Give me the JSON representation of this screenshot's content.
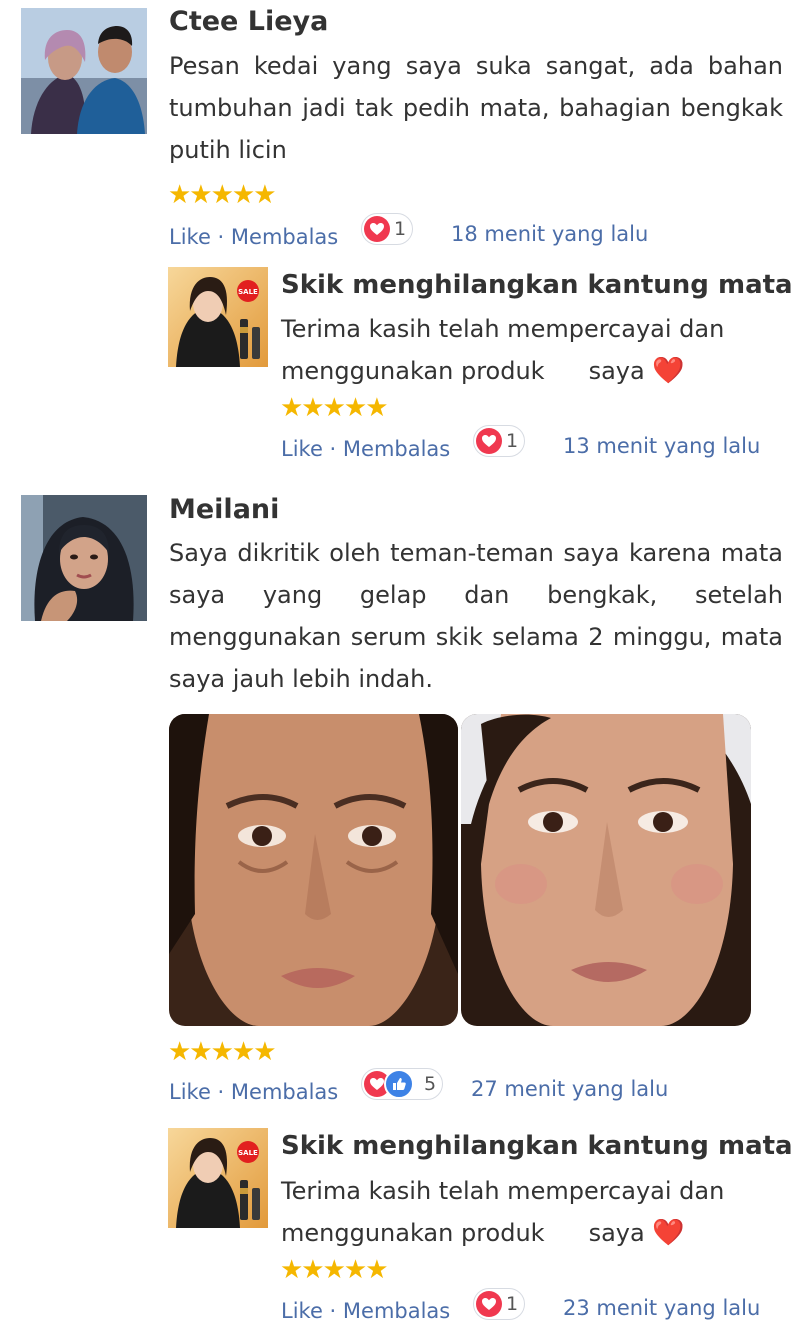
{
  "comments": [
    {
      "name": "Ctee Lieya",
      "text": "Pesan kedai yang saya suka sangat, ada bahan tumbuhan jadi tak pedih mata, bahagian bengkak putih licin",
      "rating": 5,
      "stars": "★★★★★",
      "like_label": "Like",
      "reply_label": "Membalas",
      "separator": " · ",
      "reaction_count": "1",
      "time": "18 menit yang lalu",
      "reply": {
        "name": "Skik menghilangkan kantung mata",
        "text_line1": "Terima kasih telah mempercayai dan",
        "text_line2": "menggunakan produk",
        "text_line2_end": "saya",
        "heart": "❤️",
        "rating": 5,
        "stars": "★★★★★",
        "like_label": "Like",
        "reply_label": "Membalas",
        "separator": " · ",
        "reaction_count": "1",
        "time": "13 menit yang lalu",
        "avatar_badge": "SALE"
      }
    },
    {
      "name": "Meilani",
      "text": "Saya dikritik oleh teman-teman saya karena mata saya yang gelap dan bengkak, setelah menggunakan serum skik selama 2 minggu, mata saya jauh lebih indah.",
      "rating": 5,
      "stars": "★★★★★",
      "like_label": "Like",
      "reply_label": "Membalas",
      "separator": " · ",
      "reaction_count": "5",
      "time": "27 menit yang lalu",
      "reply": {
        "name": "Skik menghilangkan kantung mata",
        "text_line1": "Terima kasih telah mempercayai dan",
        "text_line2": "menggunakan produk",
        "text_line2_end": "saya",
        "heart": "❤️",
        "rating": 5,
        "stars": "★★★★★",
        "like_label": "Like",
        "reply_label": "Membalas",
        "separator": " · ",
        "reaction_count": "1",
        "time": "23 menit yang lalu",
        "avatar_badge": "SALE"
      }
    }
  ],
  "colors": {
    "link": "#4b6da8",
    "star": "#f5b700",
    "love": "#f0384f",
    "like": "#3d82e6"
  },
  "icons": {
    "love": "heart-reaction-icon",
    "like": "thumbs-up-reaction-icon",
    "star": "star-icon"
  }
}
